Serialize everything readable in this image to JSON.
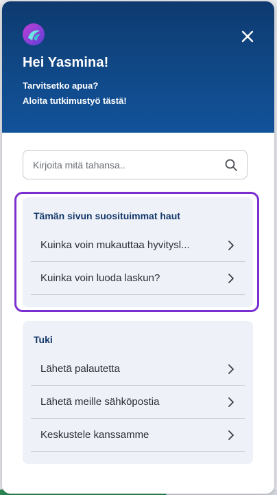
{
  "header": {
    "greeting": "Hei Yasmina!",
    "help_line_1": "Tarvitsetko apua?",
    "help_line_2": "Aloita tutkimustyö tästä!",
    "logo_icon": "brand-logo-icon",
    "close_icon": "close-icon"
  },
  "search": {
    "placeholder": "Kirjoita mitä tahansa..",
    "value": "",
    "icon": "search-icon"
  },
  "top_searches": {
    "title": "Tämän sivun suosituimmat haut",
    "items": [
      {
        "label": "Kuinka voin mukauttaa hyvitysl..."
      },
      {
        "label": "Kuinka voin luoda laskun?"
      }
    ]
  },
  "support": {
    "title": "Tuki",
    "items": [
      {
        "label": "Lähetä palautetta"
      },
      {
        "label": "Lähetä meille sähköpostia"
      },
      {
        "label": "Keskustele kanssamme"
      }
    ]
  },
  "colors": {
    "header_bg": "#104a8a",
    "card_bg": "#eef1f8",
    "highlight_border": "#7b2fd0",
    "title_text": "#13386a"
  }
}
